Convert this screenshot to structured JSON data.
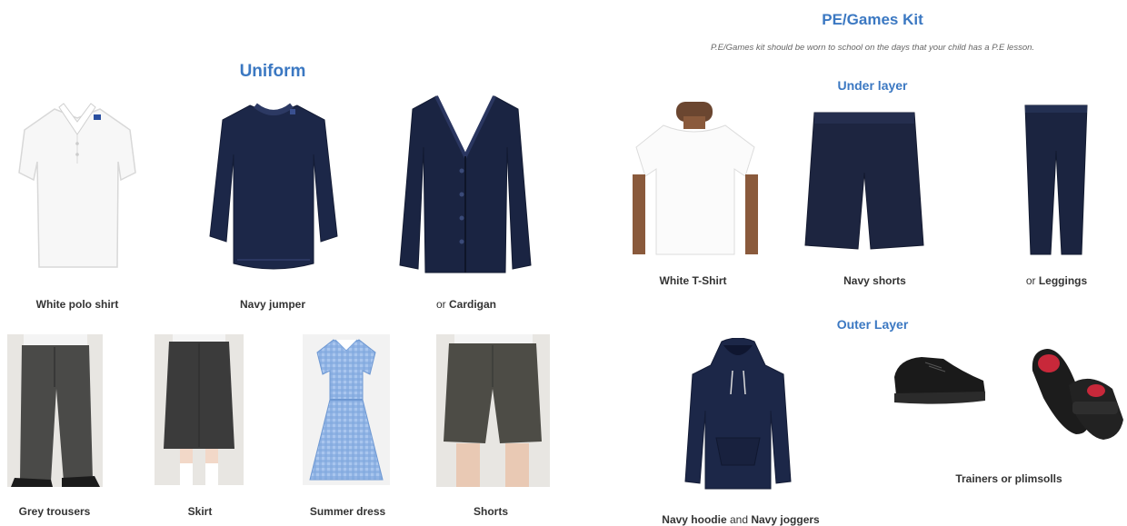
{
  "uniform": {
    "title": "Uniform",
    "items": [
      {
        "prefix": "",
        "label": "White polo shirt",
        "icon": "white-polo-shirt-image"
      },
      {
        "prefix": "",
        "label": "Navy jumper",
        "icon": "navy-jumper-image"
      },
      {
        "prefix": "or ",
        "label": "Cardigan",
        "icon": "navy-cardigan-image"
      },
      {
        "prefix": "",
        "label": "Grey trousers",
        "icon": "grey-trousers-image"
      },
      {
        "prefix": "",
        "label": "Skirt",
        "icon": "grey-skirt-image"
      },
      {
        "prefix": "",
        "label": "Summer dress",
        "icon": "blue-gingham-dress-image"
      },
      {
        "prefix": "",
        "label": "Shorts",
        "icon": "grey-shorts-image"
      }
    ]
  },
  "pe_kit": {
    "title": "PE/Games Kit",
    "note": "P.E/Games kit should be worn to school on the days that your child has a P.E lesson.",
    "under_layer": {
      "title": "Under layer",
      "items": [
        {
          "prefix": "",
          "label": "White T-Shirt",
          "icon": "white-tshirt-image"
        },
        {
          "prefix": "",
          "label": "Navy shorts",
          "icon": "navy-shorts-image"
        },
        {
          "prefix": "or ",
          "label": "Leggings",
          "icon": "navy-leggings-image"
        }
      ]
    },
    "outer_layer": {
      "title": "Outer Layer",
      "hoodie": {
        "part1": "Navy hoodie",
        "joiner": " and ",
        "part2": "Navy joggers"
      },
      "shoes": {
        "label": "Trainers or plimsolls"
      }
    }
  },
  "colors": {
    "heading_blue": "#3b78c2",
    "navy": "#1c2748",
    "grey_fabric": "#4a4a48",
    "gingham_blue": "#8fb4e6"
  }
}
